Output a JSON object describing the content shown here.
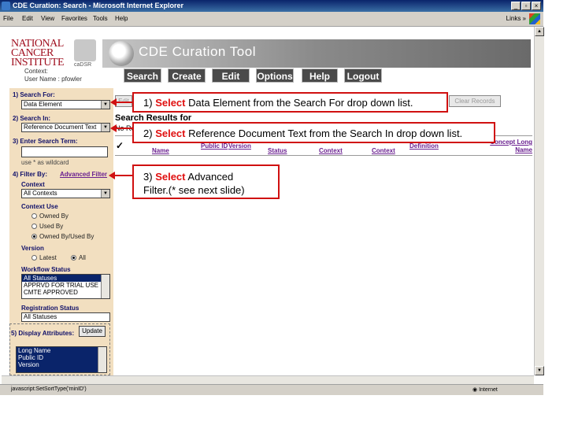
{
  "window": {
    "title": "CDE Curation: Search - Microsoft Internet Explorer",
    "menu": [
      "File",
      "Edit",
      "View",
      "Favorites",
      "Tools",
      "Help"
    ],
    "links_label": "Links",
    "status_text": "javascript:SetSortType('minID')",
    "zone": "Internet"
  },
  "header": {
    "logo_line1": "NATIONAL",
    "logo_line2": "CANCER",
    "logo_line3": "INSTITUTE",
    "cadsr": "caDSR",
    "context_label": "Context:",
    "user_label": "User Name : pfowler",
    "app_title": "CDE Curation Tool",
    "nav": [
      "Search",
      "Create",
      "Edit",
      "Options",
      "Help",
      "Logout"
    ]
  },
  "left": {
    "search_for_label": "1) Search For:",
    "search_for_value": "Data Element",
    "search_in_label": "2) Search In:",
    "search_in_value": "Reference Document Text",
    "enter_term_label": "3) Enter Search Term:",
    "term_value": "",
    "wildcard_hint": "use * as wildcard",
    "filter_label": "4) Filter By:",
    "advanced_filter": "Advanced Filter",
    "context_label": "Context",
    "context_value": "All Contexts",
    "context_use_label": "Context Use",
    "context_use_options": [
      "Owned By",
      "Used By",
      "Owned By/Used By"
    ],
    "context_use_selected": 2,
    "version_label": "Version",
    "version_options": [
      "Latest",
      "All"
    ],
    "version_selected": 1,
    "workflow_label": "Workflow Status",
    "workflow_items": [
      "All Statuses",
      "APPRVD FOR TRIAL USE",
      "CMTE APPROVED"
    ],
    "registration_label": "Registration Status",
    "registration_value": "All Statuses",
    "display_attrs_label": "5) Display Attributes:",
    "update_button": "Update",
    "attr_items": [
      "Long Name",
      "Public ID",
      "Version"
    ]
  },
  "results": {
    "edit_button": "Edit",
    "clear_button": "Clear Records",
    "title": "Search Results for",
    "no_results": "No Re",
    "columns": [
      "Name",
      "Public ID",
      "Version",
      "Status",
      "Context",
      "Context",
      "Definition",
      "Concept Long Name"
    ]
  },
  "callouts": {
    "c1_num": "1)",
    "c1_red": "Select",
    "c1_text": "Data Element from the Search For drop down list.",
    "c2_num": "2)",
    "c2_red": "Select",
    "c2_text": "Reference Document Text from the Search In drop down list.",
    "c3_num": "3)",
    "c3_red": "Select",
    "c3_text": "Advanced",
    "c3_text2": "Filter.(* see next slide)"
  },
  "colors": {
    "accent": "#d01010",
    "panel": "#f2dfc0",
    "nav_bg": "#4a4a4a",
    "header_link": "#6a2090"
  }
}
